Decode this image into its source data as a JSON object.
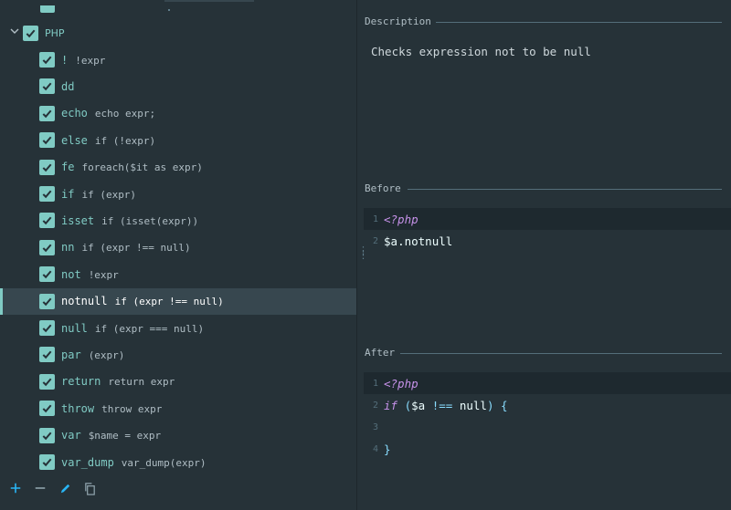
{
  "tree": {
    "group": {
      "label": "PHP",
      "checked": true,
      "expanded": true
    },
    "items": [
      {
        "name": "!",
        "example": "!expr",
        "checked": true
      },
      {
        "name": "dd",
        "example": "",
        "checked": true
      },
      {
        "name": "echo",
        "example": "echo expr;",
        "checked": true
      },
      {
        "name": "else",
        "example": "if (!expr)",
        "checked": true
      },
      {
        "name": "fe",
        "example": "foreach($it as expr)",
        "checked": true
      },
      {
        "name": "if",
        "example": "if (expr)",
        "checked": true
      },
      {
        "name": "isset",
        "example": "if (isset(expr))",
        "checked": true
      },
      {
        "name": "nn",
        "example": "if (expr !== null)",
        "checked": true
      },
      {
        "name": "not",
        "example": "!expr",
        "checked": true
      },
      {
        "name": "notnull",
        "example": "if (expr !== null)",
        "checked": true,
        "selected": true
      },
      {
        "name": "null",
        "example": "if (expr === null)",
        "checked": true
      },
      {
        "name": "par",
        "example": "(expr)",
        "checked": true
      },
      {
        "name": "return",
        "example": "return expr",
        "checked": true
      },
      {
        "name": "throw",
        "example": "throw expr",
        "checked": true
      },
      {
        "name": "var",
        "example": "$name = expr",
        "checked": true
      },
      {
        "name": "var_dump",
        "example": "var_dump(expr)",
        "checked": true
      }
    ]
  },
  "toolbar": {
    "add_icon": "plus-icon",
    "remove_icon": "minus-icon",
    "edit_icon": "pencil-icon",
    "copy_icon": "copy-icon"
  },
  "description": {
    "label": "Description",
    "text": "Checks expression not to be null"
  },
  "before": {
    "label": "Before",
    "lines": [
      {
        "num": "1",
        "tokens": [
          {
            "t": "<?php",
            "c": "kw"
          }
        ]
      },
      {
        "num": "2",
        "tokens": [
          {
            "t": "$a",
            "c": "var"
          },
          {
            "t": ".notnull",
            "c": "plain"
          }
        ]
      }
    ]
  },
  "after": {
    "label": "After",
    "lines": [
      {
        "num": "1",
        "tokens": [
          {
            "t": "<?php",
            "c": "kw"
          }
        ]
      },
      {
        "num": "2",
        "tokens": [
          {
            "t": "if",
            "c": "kw"
          },
          {
            "t": " (",
            "c": "punc"
          },
          {
            "t": "$a",
            "c": "var"
          },
          {
            "t": " !== ",
            "c": "punc"
          },
          {
            "t": "null",
            "c": "plain"
          },
          {
            "t": ") {",
            "c": "punc"
          }
        ]
      },
      {
        "num": "3",
        "tokens": []
      },
      {
        "num": "4",
        "tokens": [
          {
            "t": "}",
            "c": "punc"
          }
        ]
      }
    ]
  },
  "colors": {
    "background": "#263238",
    "accent": "#80cbc4",
    "selection": "#37474f"
  }
}
